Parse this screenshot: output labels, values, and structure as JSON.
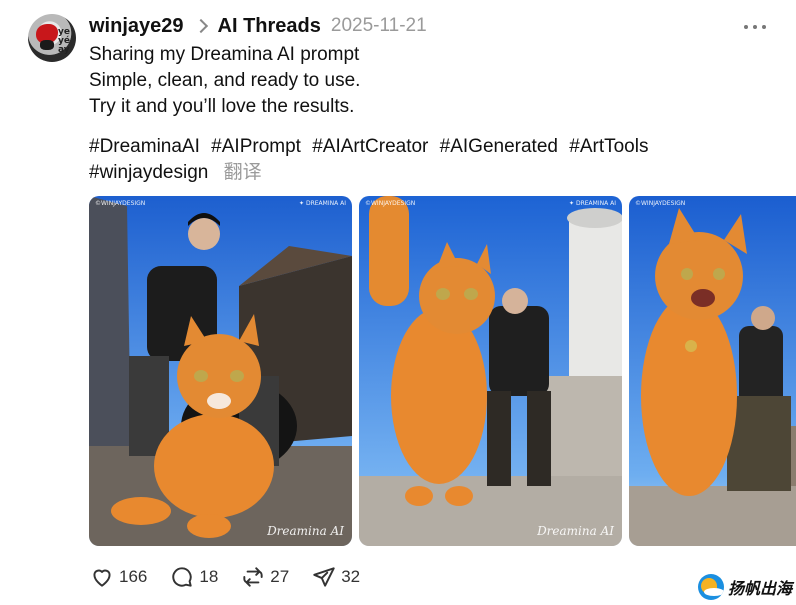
{
  "post": {
    "username": "winjaye29",
    "thread": "AI Threads",
    "date": "2025-11-21",
    "avatar_text": "ye\nyé\nay",
    "lines": [
      "Sharing my Dreamina AI prompt",
      "Simple, clean, and ready to use.",
      "Try it and you’ll love the results."
    ],
    "tags": [
      "#DreaminaAI",
      "#AIPrompt",
      "#AIArtCreator",
      "#AIGenerated",
      "#ArtTools",
      "#winjaydesign"
    ],
    "translate_label": "翻译"
  },
  "images": [
    {
      "wm_left": "©WINJAYDESIGN",
      "wm_right": "✦ DREAMINA AI",
      "wm_bottom": "Dreamina AI"
    },
    {
      "wm_left": "©WINJAYDESIGN",
      "wm_right": "✦ DREAMINA AI",
      "wm_bottom": "Dreamina AI"
    },
    {
      "wm_left": "©WINJAYDESIGN",
      "wm_right": "",
      "wm_bottom": ""
    }
  ],
  "actions": {
    "likes": "166",
    "comments": "18",
    "reposts": "27",
    "shares": "32"
  },
  "brand": {
    "name": "扬帆出海"
  },
  "colors": {
    "sky": "#1f6fd6",
    "cat": "#e8892f",
    "meta_gray": "#9a9a9a"
  }
}
